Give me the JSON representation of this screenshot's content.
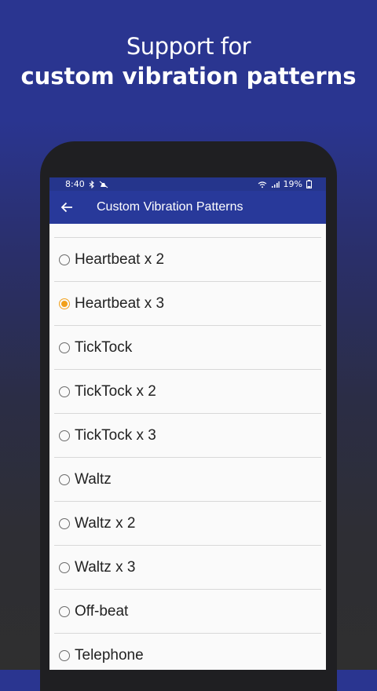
{
  "headline": {
    "line1": "Support for",
    "line2": "custom vibration patterns"
  },
  "status_bar": {
    "time": "8:40",
    "battery": "19%",
    "icons": [
      "bluetooth-icon",
      "mute-icon",
      "wifi-icon",
      "signal-icon",
      "battery-icon"
    ]
  },
  "app_bar": {
    "back_icon": "back-arrow-icon",
    "title": "Custom Vibration Patterns"
  },
  "options": [
    {
      "label": "Heartbeat x 2",
      "selected": false
    },
    {
      "label": "Heartbeat x 3",
      "selected": true
    },
    {
      "label": "TickTock",
      "selected": false
    },
    {
      "label": "TickTock x 2",
      "selected": false
    },
    {
      "label": "TickTock x 3",
      "selected": false
    },
    {
      "label": "Waltz",
      "selected": false
    },
    {
      "label": "Waltz x 2",
      "selected": false
    },
    {
      "label": "Waltz x 3",
      "selected": false
    },
    {
      "label": "Off-beat",
      "selected": false
    },
    {
      "label": "Telephone",
      "selected": false
    }
  ],
  "colors": {
    "accent": "#f2a01a",
    "app_bar": "#28399a",
    "status_bar": "#25358c"
  }
}
